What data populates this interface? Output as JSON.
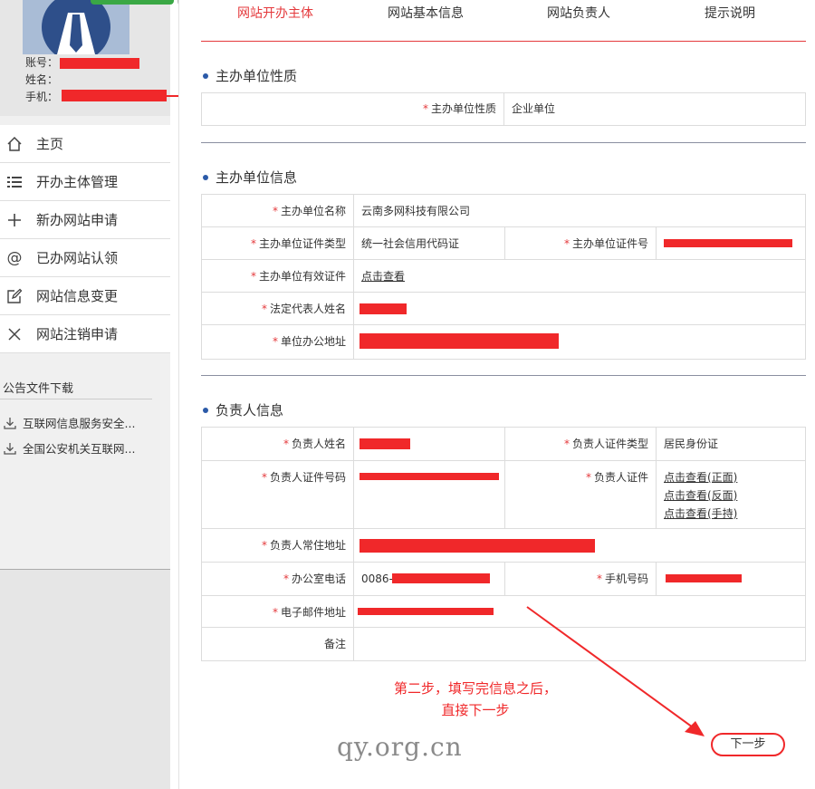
{
  "sidebar": {
    "account": {
      "account_label": "账号：",
      "name_label": "姓名：",
      "phone_label": "手机："
    },
    "menu": [
      {
        "icon": "home-icon",
        "label": "主页"
      },
      {
        "icon": "list-icon",
        "label": "开办主体管理"
      },
      {
        "icon": "plus-icon",
        "label": "新办网站申请"
      },
      {
        "icon": "at-icon",
        "label": "已办网站认领"
      },
      {
        "icon": "edit-icon",
        "label": "网站信息变更"
      },
      {
        "icon": "close-icon",
        "label": "网站注销申请"
      }
    ],
    "notice_title": "公告文件下载",
    "downloads": [
      {
        "label": "互联网信息服务安全..."
      },
      {
        "label": "全国公安机关互联网..."
      }
    ]
  },
  "tabs": [
    {
      "label": "网站开办主体",
      "active": true
    },
    {
      "label": "网站基本信息",
      "active": false
    },
    {
      "label": "网站负责人",
      "active": false
    },
    {
      "label": "提示说明",
      "active": false
    }
  ],
  "sections": {
    "nature": {
      "title": "主办单位性质",
      "label": "主办单位性质",
      "value": "企业单位"
    },
    "org": {
      "title": "主办单位信息",
      "name_label": "主办单位名称",
      "name_value": "云南多网科技有限公司",
      "cert_type_label": "主办单位证件类型",
      "cert_type_value": "统一社会信用代码证",
      "cert_no_label": "主办单位证件号",
      "valid_cert_label": "主办单位有效证件",
      "valid_cert_link": "点击查看",
      "legal_rep_label": "法定代表人姓名",
      "address_label": "单位办公地址"
    },
    "person": {
      "title": "负责人信息",
      "name_label": "负责人姓名",
      "cert_type_label": "负责人证件类型",
      "cert_type_value": "居民身份证",
      "cert_no_label": "负责人证件号码",
      "cert_label": "负责人证件",
      "cert_links": [
        "点击查看(正面)",
        "点击查看(反面)",
        "点击查看(手持)"
      ],
      "address_label": "负责人常住地址",
      "office_phone_label": "办公室电话",
      "office_phone_prefix": "0086-",
      "mobile_label": "手机号码",
      "email_label": "电子邮件地址",
      "remark_label": "备注"
    }
  },
  "annotation": {
    "line1": "第二步，填写完信息之后，",
    "line2": "直接下一步"
  },
  "watermark": "qy.org.cn",
  "next_button": "下一步",
  "colors": {
    "accent": "#e4393c",
    "redact": "#f0282a",
    "dot": "#2b5aa8"
  }
}
